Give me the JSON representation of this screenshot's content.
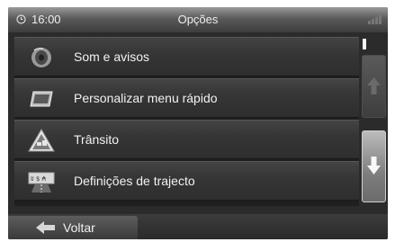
{
  "status_bar": {
    "clock_icon": "clock-icon",
    "time": "16:00",
    "title": "Opções",
    "signal_icon": "signal-bars-icon"
  },
  "menu": {
    "items": [
      {
        "label": "Som e avisos",
        "icon": "speaker-icon"
      },
      {
        "label": "Personalizar menu rápido",
        "icon": "quick-menu-icon"
      },
      {
        "label": "Trânsito",
        "icon": "traffic-warning-icon"
      },
      {
        "label": "Definições de trajecto",
        "icon": "route-settings-icon"
      }
    ]
  },
  "scroll": {
    "up_icon": "arrow-up-icon",
    "down_icon": "arrow-down-icon"
  },
  "footer": {
    "back_label": "Voltar",
    "back_icon": "arrow-left-icon"
  }
}
